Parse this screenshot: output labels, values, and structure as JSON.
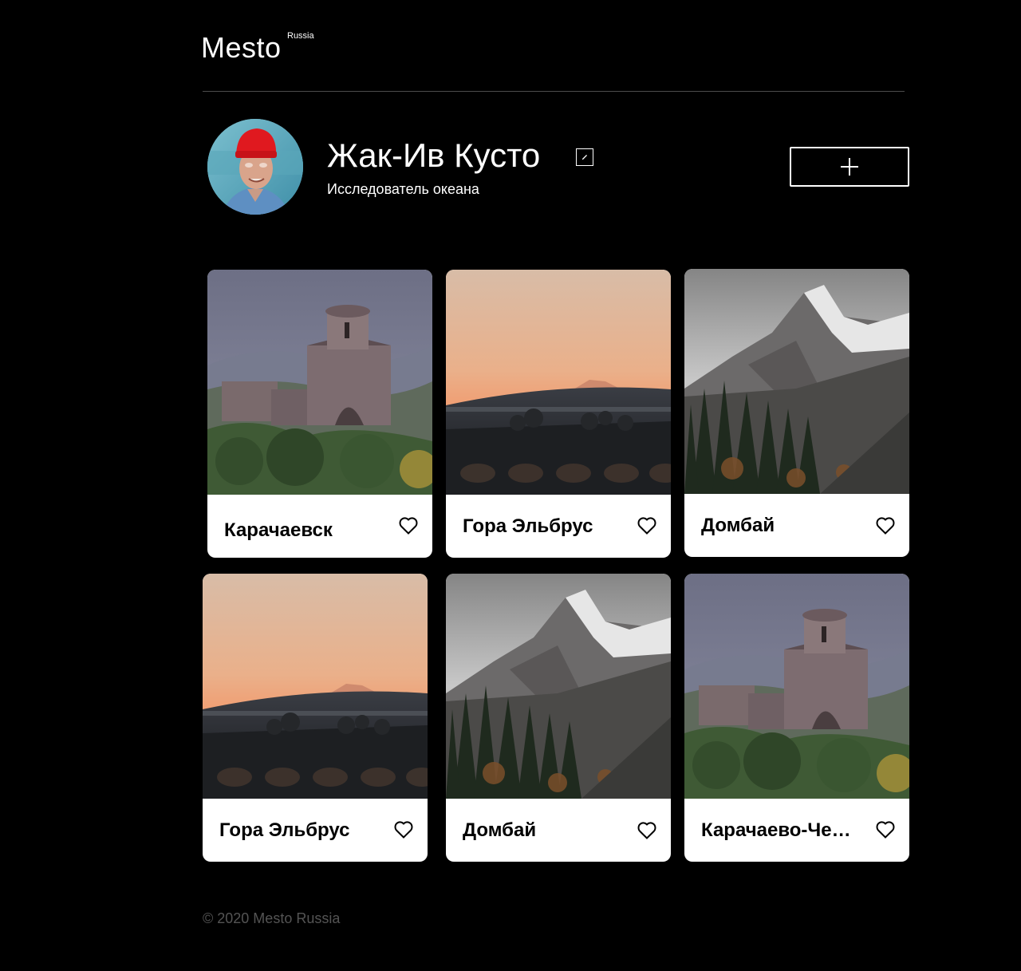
{
  "header": {
    "logo_text": "Mesto",
    "logo_superscript": "Russia"
  },
  "profile": {
    "name": "Жак-Ив Кусто",
    "about": "Исследователь океана",
    "avatar_icon": "avatar-photo",
    "edit_icon": "pencil-icon",
    "add_icon": "plus-icon"
  },
  "cards": [
    {
      "title": "Карачаевск",
      "scene": "church",
      "liked": false
    },
    {
      "title": "Гора Эльбрус",
      "scene": "sunset",
      "liked": false
    },
    {
      "title": "Домбай",
      "scene": "mountain",
      "liked": false
    },
    {
      "title": "Гора Эльбрус",
      "scene": "sunset",
      "liked": false
    },
    {
      "title": "Домбай",
      "scene": "mountain",
      "liked": false
    },
    {
      "title": "Карачаево-Черкесия",
      "scene": "church",
      "liked": false
    }
  ],
  "footer": {
    "copyright": "© 2020 Mesto Russia"
  },
  "colors": {
    "background": "#000000",
    "card": "#ffffff",
    "footer_text": "#545454",
    "divider": "#545454"
  }
}
